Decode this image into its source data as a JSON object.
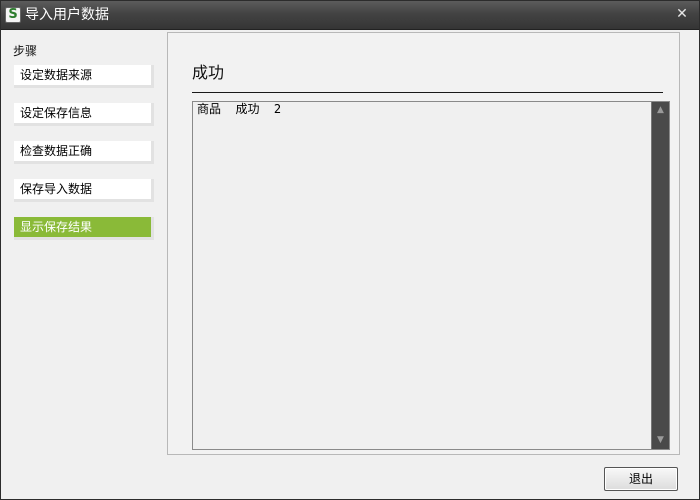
{
  "window": {
    "title": "导入用户数据",
    "app_icon_glyph": "S",
    "close_glyph": "✕"
  },
  "sidebar": {
    "label": "步骤",
    "items": [
      {
        "label": "设定数据来源",
        "active": false
      },
      {
        "label": "设定保存信息",
        "active": false
      },
      {
        "label": "检查数据正确",
        "active": false
      },
      {
        "label": "保存导入数据",
        "active": false
      },
      {
        "label": "显示保存结果",
        "active": true
      }
    ],
    "active_color": "#8aba38"
  },
  "main": {
    "title": "成功",
    "result_text": "商品  成功  2"
  },
  "scrollbar": {
    "up_glyph": "▲",
    "down_glyph": "▼"
  },
  "footer": {
    "exit_label": "退出"
  }
}
